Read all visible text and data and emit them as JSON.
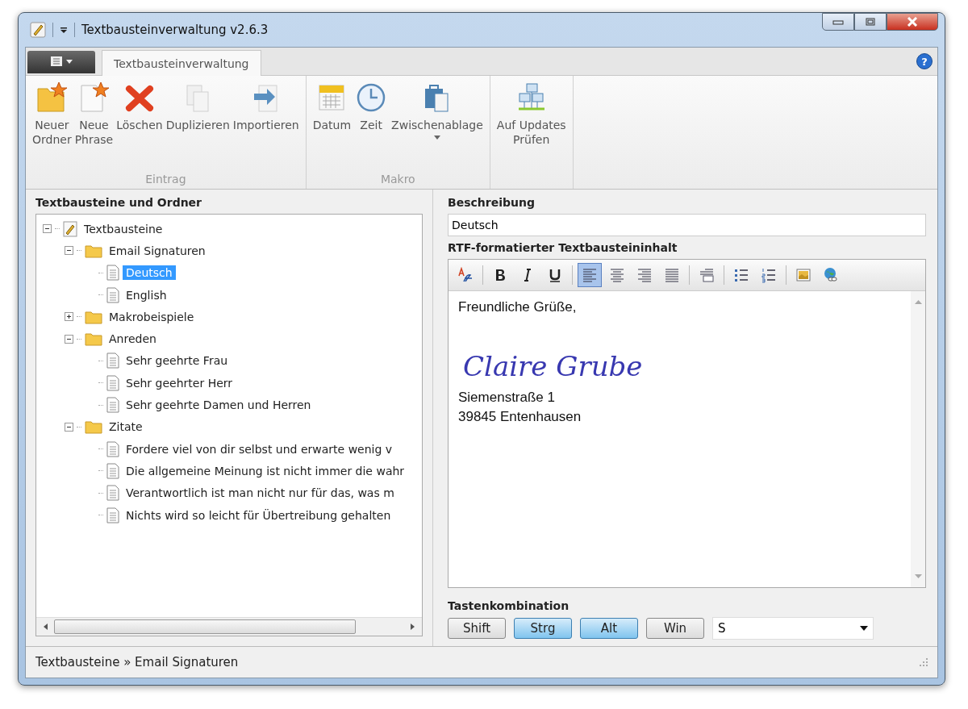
{
  "window": {
    "title": "Textbausteinverwaltung v2.6.3"
  },
  "ribbon": {
    "help": "?",
    "tabs": [
      {
        "label": "Textbausteinverwaltung",
        "selected": true
      }
    ],
    "groups": [
      {
        "label": "Eintrag",
        "buttons": [
          {
            "label": "Neuer\nOrdner",
            "kind": "new-folder"
          },
          {
            "label": "Neue\nPhrase",
            "kind": "new-phrase"
          },
          {
            "label": "Löschen",
            "kind": "delete"
          },
          {
            "label": "Duplizieren",
            "kind": "duplicate"
          },
          {
            "label": "Importieren",
            "kind": "import"
          }
        ]
      },
      {
        "label": "Makro",
        "buttons": [
          {
            "label": "Datum",
            "kind": "date"
          },
          {
            "label": "Zeit",
            "kind": "time"
          },
          {
            "label": "Zwischenablage",
            "kind": "clipboard",
            "dropdown": true
          }
        ]
      },
      {
        "buttons": [
          {
            "label": "Auf Updates\nPrüfen",
            "kind": "updates"
          }
        ]
      }
    ]
  },
  "tree_panel": {
    "title": "Textbausteine und Ordner",
    "items": [
      {
        "label": "Textbausteine",
        "kind": "root",
        "expanded": true,
        "selected": false,
        "children": [
          {
            "label": "Email Signaturen",
            "kind": "folder",
            "expanded": true,
            "selected": false,
            "children": [
              {
                "label": "Deutsch",
                "kind": "document",
                "selected": true
              },
              {
                "label": "English",
                "kind": "document",
                "selected": false
              }
            ]
          },
          {
            "label": "Makrobeispiele",
            "kind": "folder",
            "expanded": false,
            "selected": false
          },
          {
            "label": "Anreden",
            "kind": "folder",
            "expanded": true,
            "selected": false,
            "children": [
              {
                "label": "Sehr geehrte Frau",
                "kind": "document",
                "selected": false
              },
              {
                "label": "Sehr geehrter Herr",
                "kind": "document",
                "selected": false
              },
              {
                "label": "Sehr geehrte Damen und Herren",
                "kind": "document",
                "selected": false
              }
            ]
          },
          {
            "label": "Zitate",
            "kind": "folder",
            "expanded": true,
            "selected": false,
            "children": [
              {
                "label": "Fordere viel von dir selbst und erwarte wenig v",
                "kind": "document",
                "selected": false
              },
              {
                "label": "Die allgemeine Meinung ist nicht immer die wahr",
                "kind": "document",
                "selected": false
              },
              {
                "label": "Verantwortlich ist man nicht nur für das, was m",
                "kind": "document",
                "selected": false
              },
              {
                "label": "Nichts wird so leicht für Übertreibung gehalten",
                "kind": "document",
                "selected": false
              }
            ]
          }
        ]
      }
    ]
  },
  "description": {
    "label": "Beschreibung",
    "value": "Deutsch"
  },
  "editor": {
    "label": "RTF-formatierter Textbausteininhalt",
    "toolbar": [
      {
        "kind": "font",
        "on": false
      },
      {
        "kind": "sep"
      },
      {
        "kind": "bold",
        "on": false
      },
      {
        "kind": "italic",
        "on": false
      },
      {
        "kind": "underline",
        "on": false
      },
      {
        "kind": "sep"
      },
      {
        "kind": "align-left",
        "on": true
      },
      {
        "kind": "align-center",
        "on": false
      },
      {
        "kind": "align-right",
        "on": false
      },
      {
        "kind": "justify",
        "on": false
      },
      {
        "kind": "sep"
      },
      {
        "kind": "indent",
        "on": false
      },
      {
        "kind": "sep"
      },
      {
        "kind": "bullets",
        "on": false
      },
      {
        "kind": "numbering",
        "on": false
      },
      {
        "kind": "sep"
      },
      {
        "kind": "image",
        "on": false
      },
      {
        "kind": "link",
        "on": false
      }
    ],
    "lines": [
      {
        "kind": "text",
        "text": "Freundliche Grüße,"
      },
      {
        "kind": "signature",
        "text": "Claire Grube"
      },
      {
        "kind": "text",
        "text": "Siemenstraße 1"
      },
      {
        "kind": "text",
        "text": "39845 Entenhausen"
      }
    ]
  },
  "hotkey": {
    "label": "Tastenkombination",
    "modifiers": [
      {
        "label": "Shift",
        "selected": false
      },
      {
        "label": "Strg",
        "selected": true
      },
      {
        "label": "Alt",
        "selected": true
      },
      {
        "label": "Win",
        "selected": false
      }
    ],
    "key": "S"
  },
  "status_bar": {
    "path": "Textbausteine » Email Signaturen"
  }
}
